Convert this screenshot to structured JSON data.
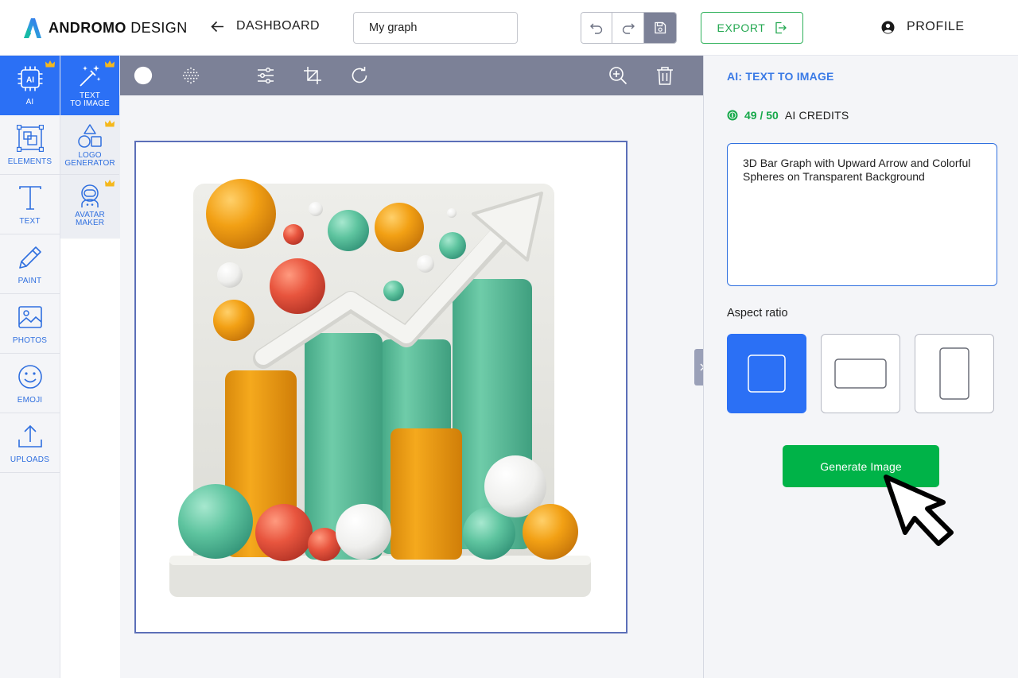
{
  "brand": {
    "bold": "ANDROMO",
    "light": " DESIGN"
  },
  "header": {
    "back_label": "DASHBOARD",
    "document_name": "My graph",
    "export_label": "EXPORT",
    "profile_label": "PROFILE"
  },
  "rail": {
    "items": [
      {
        "label": "AI",
        "icon": "ai-chip-icon",
        "premium": true,
        "active": true
      },
      {
        "label": "ELEMENTS",
        "icon": "elements-icon"
      },
      {
        "label": "TEXT",
        "icon": "text-icon"
      },
      {
        "label": "PAINT",
        "icon": "pencil-icon"
      },
      {
        "label": "PHOTOS",
        "icon": "image-icon"
      },
      {
        "label": "EMOJI",
        "icon": "smiley-icon"
      },
      {
        "label": "UPLOADS",
        "icon": "upload-icon"
      }
    ]
  },
  "ai_tools": {
    "items": [
      {
        "label_line1": "TEXT",
        "label_line2": "TO IMAGE",
        "icon": "magic-wand-icon",
        "premium": true,
        "active": true
      },
      {
        "label_line1": "LOGO",
        "label_line2": "GENERATOR",
        "icon": "shapes-icon",
        "premium": true
      },
      {
        "label_line1": "AVATAR",
        "label_line2": "MAKER",
        "icon": "astronaut-icon",
        "premium": true
      }
    ]
  },
  "toolbar": {
    "tools": [
      "color-swatch-icon",
      "dots-pattern-icon",
      "adjust-sliders-icon",
      "crop-icon",
      "rotate-icon",
      "zoom-in-icon",
      "trash-icon"
    ]
  },
  "panel": {
    "title": "AI: TEXT TO IMAGE",
    "credits_value": "49 / 50",
    "credits_label": "AI CREDITS",
    "prompt": "3D Bar Graph with Upward Arrow and Colorful Spheres on Transparent Background",
    "aspect_label": "Aspect ratio",
    "aspect_options": [
      "square",
      "landscape",
      "portrait"
    ],
    "aspect_selected": "square",
    "generate_label": "Generate Image"
  },
  "colors": {
    "accent": "#2b70f5",
    "toolbar": "#7c8197",
    "green": "#00b348",
    "orange": "#f2a014",
    "teal": "#5ec49f",
    "red": "#e8553e"
  }
}
